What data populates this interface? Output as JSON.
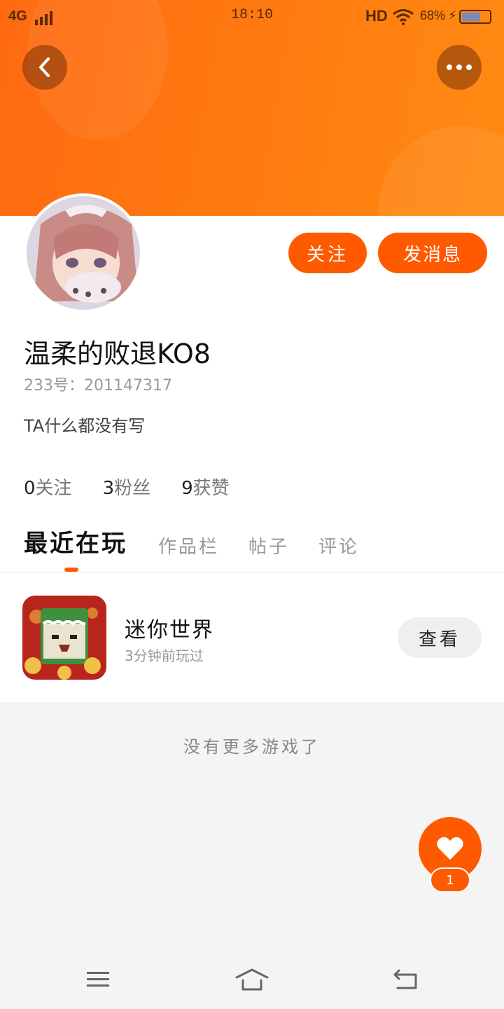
{
  "status_bar": {
    "network": "4G",
    "time": "18:10",
    "hd": "HD",
    "battery_percent": "68%",
    "battery_level": 0.68,
    "charging_icon": "bolt-icon"
  },
  "header": {
    "back_icon": "chevron-left-icon",
    "more_icon": "more-dots-icon",
    "accent_color": "#ff6a12"
  },
  "profile": {
    "follow_label": "关注",
    "message_label": "发消息",
    "name": "温柔的败退KO8",
    "uid": "233号：201147317",
    "bio": "TA什么都没有写",
    "stats": [
      {
        "count": "0",
        "label": "关注"
      },
      {
        "count": "3",
        "label": "粉丝"
      },
      {
        "count": "9",
        "label": "获赞"
      }
    ]
  },
  "tabs": [
    {
      "label": "最近在玩",
      "active": true
    },
    {
      "label": "作品栏",
      "active": false
    },
    {
      "label": "帖子",
      "active": false
    },
    {
      "label": "评论",
      "active": false
    }
  ],
  "games": [
    {
      "name": "迷你世界",
      "played": "3分钟前玩过",
      "action": "查看"
    }
  ],
  "footer_text": "没有更多游戏了",
  "like_fab": {
    "icon": "heart-icon",
    "count": "1"
  },
  "nav": {
    "menu_icon": "menu-icon",
    "home_icon": "home-icon",
    "back_icon": "back-arrow-icon"
  }
}
